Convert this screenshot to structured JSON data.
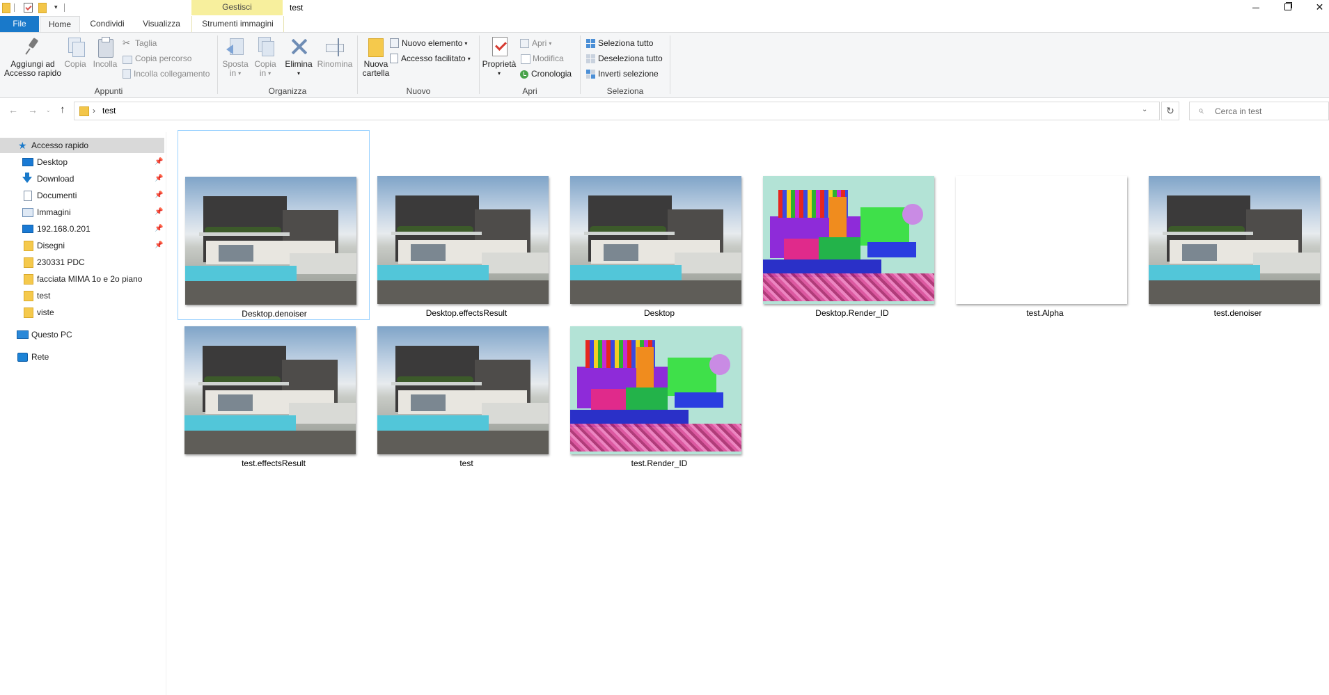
{
  "window": {
    "title": "test",
    "contextual_tab_group": "Gestisci",
    "controls": {
      "minimize_icon": "minimize-icon",
      "maximize_icon": "restore-icon",
      "close_icon": "close-icon"
    }
  },
  "quick_access_toolbar": {
    "down_arrow": "▾"
  },
  "ribbon_tabs": {
    "file": "File",
    "home": "Home",
    "condividi": "Condividi",
    "visualizza": "Visualizza",
    "strumenti_immagini": "Strumenti immagini",
    "collapse": "^",
    "help": "?"
  },
  "ribbon": {
    "appunti": {
      "label": "Appunti",
      "pin_line1": "Aggiungi ad",
      "pin_line2": "Accesso rapido",
      "copy": "Copia",
      "paste": "Incolla",
      "cut": "Taglia",
      "copy_path": "Copia percorso",
      "paste_link": "Incolla collegamento"
    },
    "organizza": {
      "label": "Organizza",
      "move_line1": "Sposta",
      "move_line2": "in",
      "copyto_line1": "Copia",
      "copyto_line2": "in",
      "delete": "Elimina",
      "rename": "Rinomina"
    },
    "nuovo": {
      "label": "Nuovo",
      "new_folder_line1": "Nuova",
      "new_folder_line2": "cartella",
      "new_item": "Nuovo elemento",
      "easy_access": "Accesso facilitato"
    },
    "apri": {
      "label": "Apri",
      "properties": "Proprietà",
      "open": "Apri",
      "edit": "Modifica",
      "history": "Cronologia"
    },
    "seleziona": {
      "label": "Seleziona",
      "select_all": "Seleziona tutto",
      "select_none": "Deseleziona tutto",
      "invert": "Inverti selezione"
    }
  },
  "address_bar": {
    "path": "test",
    "chevron": "›",
    "dropdown": "⌄",
    "refresh": "↻"
  },
  "search": {
    "placeholder": "Cerca in test",
    "icon": "⌕"
  },
  "navigation": {
    "back": "←",
    "forward": "→",
    "recent": "⌄",
    "up": "↑"
  },
  "nav_pane": {
    "quick_access": "Accesso rapido",
    "pinned": [
      {
        "label": "Desktop",
        "icon": "desktop-icon"
      },
      {
        "label": "Download",
        "icon": "download-icon"
      },
      {
        "label": "Documenti",
        "icon": "documents-icon"
      },
      {
        "label": "Immagini",
        "icon": "pictures-icon"
      },
      {
        "label": "192.168.0.201",
        "icon": "network-drive-icon"
      },
      {
        "label": "Disegni",
        "icon": "folder-icon"
      }
    ],
    "folders": [
      {
        "label": "230331 PDC"
      },
      {
        "label": "facciata MIMA 1o e 2o piano"
      },
      {
        "label": "test"
      },
      {
        "label": "viste"
      }
    ],
    "this_pc": "Questo PC",
    "network": "Rete"
  },
  "files": [
    {
      "name": "Desktop.denoiser",
      "kind": "render",
      "selected": true
    },
    {
      "name": "Desktop.effectsResult",
      "kind": "render"
    },
    {
      "name": "Desktop",
      "kind": "render"
    },
    {
      "name": "Desktop.Render_ID",
      "kind": "idmap"
    },
    {
      "name": "test.Alpha",
      "kind": "alpha"
    },
    {
      "name": "test.denoiser",
      "kind": "render"
    },
    {
      "name": "test.effectsResult",
      "kind": "render"
    },
    {
      "name": "test",
      "kind": "render"
    },
    {
      "name": "test.Render_ID",
      "kind": "idmap"
    }
  ],
  "colors": {
    "accent": "#1979ca",
    "contextual_tab": "#f7ef9d",
    "selection_border": "#99d1ff",
    "nav_selected": "#d9d9d9"
  }
}
